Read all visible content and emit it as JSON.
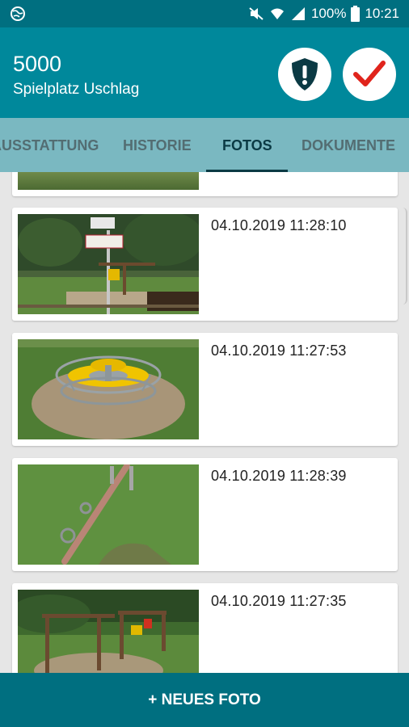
{
  "statusbar": {
    "battery": "100%",
    "time": "10:21"
  },
  "header": {
    "code": "5000",
    "subtitle": "Spielplatz Uschlag",
    "shield_icon": "shield-exclamation-icon",
    "check_icon": "checkmark-icon"
  },
  "tabs": [
    {
      "label": "AUSSTATTUNG"
    },
    {
      "label": "HISTORIE"
    },
    {
      "label": "FOTOS"
    },
    {
      "label": "DOKUMENTE"
    }
  ],
  "photos": [
    {
      "timestamp": "04.10.2019 11:28:10",
      "scene": "playground-sign"
    },
    {
      "timestamp": "04.10.2019 11:27:53",
      "scene": "merry-go-round"
    },
    {
      "timestamp": "04.10.2019 11:28:39",
      "scene": "seesaw"
    },
    {
      "timestamp": "04.10.2019 11:27:35",
      "scene": "swing-set"
    }
  ],
  "footer": {
    "new_photo_label": "+ NEUES FOTO"
  },
  "colors": {
    "statusbar": "#006f80",
    "appbar": "#00889b",
    "tabbar": "#7ab8c1",
    "active_tab": "#0b3a44",
    "check": "#e0241c"
  }
}
